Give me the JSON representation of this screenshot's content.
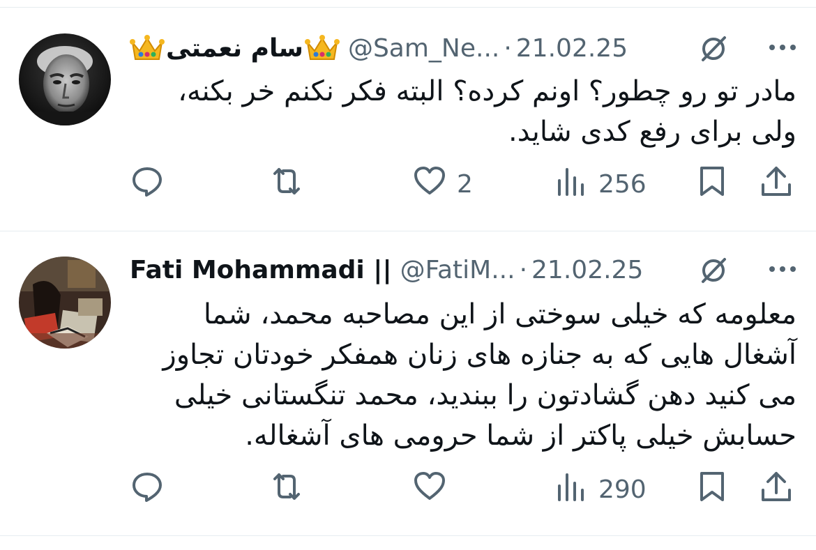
{
  "tweets": [
    {
      "name": "سام نعمتی",
      "handle": "@Sam_Ne...",
      "separator": "·",
      "date": "21.02.25",
      "text": "مادر تو رو چطور؟ اونم کرده؟ البته فکر نکنم خر بکنه،\nولی برای رفع کدی شاید.",
      "replies": "",
      "retweets": "",
      "likes": "2",
      "views": "256"
    },
    {
      "name": "Fati Mohammadi ||",
      "handle": "@FatiM...",
      "separator": "·",
      "date": "21.02.25",
      "text": "معلومه که خیلی سوختی از این مصاحبه محمد، شما\nآشغال هایی که به جنازه های زنان همفکر خودتان تجاوز\nمی کنید دهن گشادتون را ببندید، محمد تنگستانی خیلی\nحسابش خیلی پاکتر از شما حرومی های آشغاله.",
      "replies": "",
      "retweets": "",
      "likes": "",
      "views": "290"
    }
  ],
  "icons": [
    "crown-icon",
    "grok-icon",
    "more-icon",
    "reply-icon",
    "retweet-icon",
    "like-icon",
    "views-icon",
    "bookmark-icon",
    "share-icon"
  ],
  "colors": {
    "text": "#0f1419",
    "secondary": "#536471",
    "divider": "#e6ecf0"
  }
}
